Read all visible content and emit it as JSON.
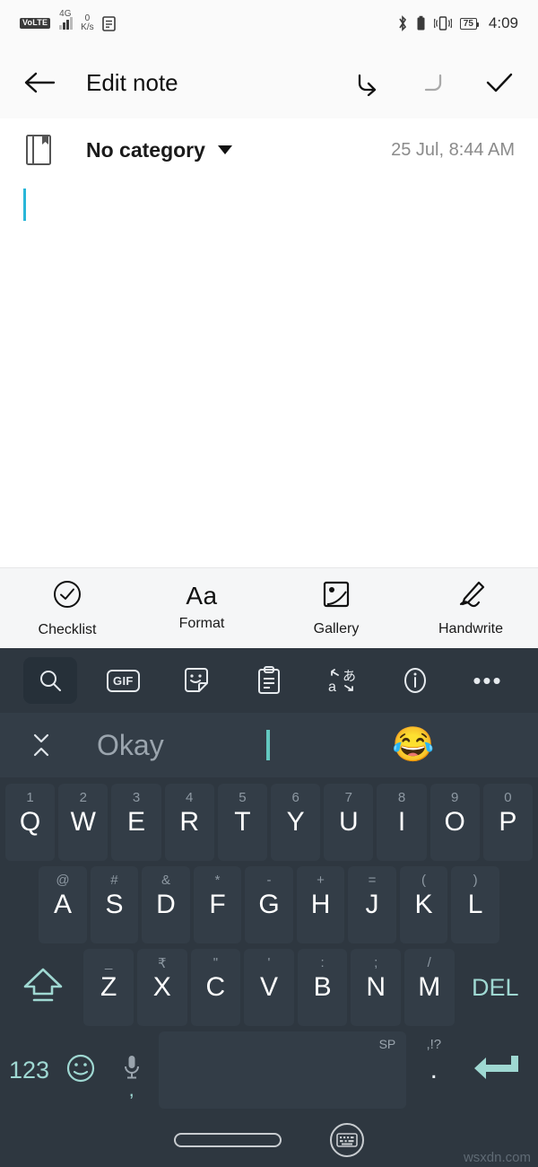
{
  "statusbar": {
    "network_badge": "VoLTE",
    "network_type": "4G",
    "speed_value": "0",
    "speed_unit": "K/s",
    "icons": [
      "volte-icon",
      "signal-icon",
      "network-speed",
      "document-icon",
      "bluetooth-icon",
      "battery-saver-icon",
      "vibrate-icon"
    ],
    "battery_percent": "75",
    "time": "4:09"
  },
  "appbar": {
    "back_label": "back-arrow",
    "title": "Edit note",
    "undo_label": "undo",
    "redo_label": "redo",
    "done_label": "done"
  },
  "meta": {
    "notebook_icon": "notebook-icon",
    "category": "No category",
    "date": "25 Jul, 8:44 AM"
  },
  "note": {
    "content": "",
    "cursor_color": "#29b6d8"
  },
  "note_toolbar": {
    "items": [
      {
        "label": "Checklist",
        "icon": "check-circle-icon"
      },
      {
        "label": "Format",
        "icon": "format-aa-icon",
        "glyph": "Aa"
      },
      {
        "label": "Gallery",
        "icon": "image-icon"
      },
      {
        "label": "Handwrite",
        "icon": "pen-icon"
      }
    ]
  },
  "keyboard": {
    "toolbar": [
      {
        "name": "search-icon",
        "label": "Search",
        "active": true
      },
      {
        "name": "gif-icon",
        "label": "GIF"
      },
      {
        "name": "sticker-icon",
        "label": "Stickers"
      },
      {
        "name": "clipboard-icon",
        "label": "Clipboard"
      },
      {
        "name": "translate-icon",
        "label": "Translate"
      },
      {
        "name": "info-icon",
        "label": "Info"
      },
      {
        "name": "more-icon",
        "label": "More"
      }
    ],
    "suggestions": {
      "expand_icon": "expand-collapse-icon",
      "word": "Okay",
      "emoji": "😂"
    },
    "row1": [
      {
        "main": "Q",
        "hint": "1"
      },
      {
        "main": "W",
        "hint": "2"
      },
      {
        "main": "E",
        "hint": "3"
      },
      {
        "main": "R",
        "hint": "4"
      },
      {
        "main": "T",
        "hint": "5"
      },
      {
        "main": "Y",
        "hint": "6"
      },
      {
        "main": "U",
        "hint": "7"
      },
      {
        "main": "I",
        "hint": "8"
      },
      {
        "main": "O",
        "hint": "9"
      },
      {
        "main": "P",
        "hint": "0"
      }
    ],
    "row2": [
      {
        "main": "A",
        "hint": "@"
      },
      {
        "main": "S",
        "hint": "#"
      },
      {
        "main": "D",
        "hint": "&"
      },
      {
        "main": "F",
        "hint": "*"
      },
      {
        "main": "G",
        "hint": "-"
      },
      {
        "main": "H",
        "hint": "+"
      },
      {
        "main": "J",
        "hint": "="
      },
      {
        "main": "K",
        "hint": "("
      },
      {
        "main": "L",
        "hint": ")"
      }
    ],
    "row3": [
      {
        "main": "Z",
        "hint": "_"
      },
      {
        "main": "X",
        "hint": "₹"
      },
      {
        "main": "C",
        "hint": "\""
      },
      {
        "main": "V",
        "hint": "'"
      },
      {
        "main": "B",
        "hint": ":"
      },
      {
        "main": "N",
        "hint": ";"
      },
      {
        "main": "M",
        "hint": "/"
      }
    ],
    "shift_label": "shift-icon",
    "delete_label": "DEL",
    "row4": {
      "numeric_label": "123",
      "emoji_label": "emoji-icon",
      "mic_label": "mic-icon",
      "mic_secondary": ",",
      "space_hint": "SP",
      "space_label": "",
      "period_hint": ",!?",
      "period_main": ".",
      "enter_label": "enter-icon"
    }
  },
  "navbar": {
    "home_label": "home-pill",
    "hide_keyboard_label": "hide-keyboard"
  },
  "watermark": "wsxdn.com",
  "colors": {
    "accent_teal": "#9fd8d2",
    "keyboard_bg": "#2e3740",
    "key_bg": "#333d47",
    "cursor": "#29b6d8"
  }
}
